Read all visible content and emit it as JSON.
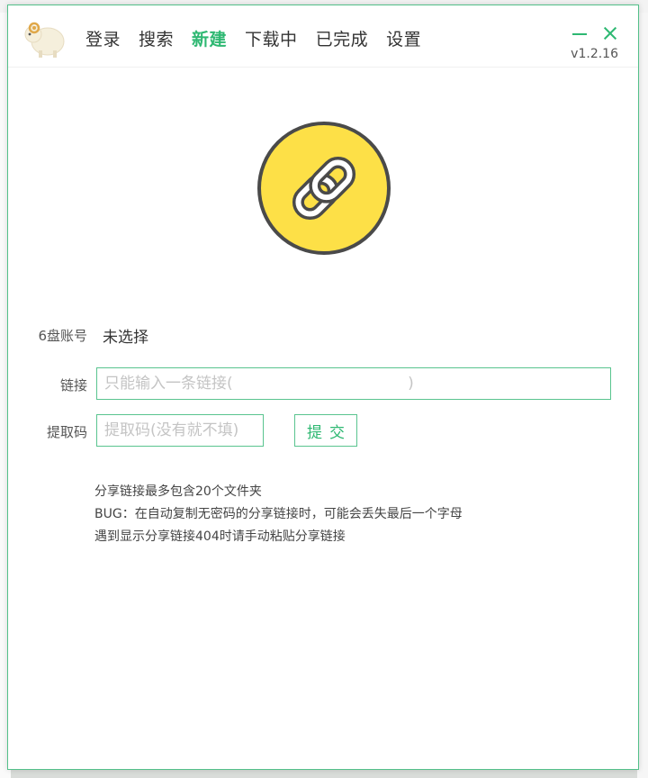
{
  "nav": {
    "items": [
      {
        "label": "登录",
        "active": false
      },
      {
        "label": "搜索",
        "active": false
      },
      {
        "label": "新建",
        "active": true
      },
      {
        "label": "下载中",
        "active": false
      },
      {
        "label": "已完成",
        "active": false
      },
      {
        "label": "设置",
        "active": false
      }
    ]
  },
  "app": {
    "version": "v1.2.16"
  },
  "icons": {
    "logo": "sheep-logo-icon",
    "main": "chain-link-icon",
    "minimize": "minimize-icon",
    "close": "close-icon"
  },
  "colors": {
    "accent": "#2eb872",
    "border": "#59c48f",
    "link_circle_fill": "#fde047",
    "link_circle_stroke": "#4a4a4a"
  },
  "form": {
    "account_label": "6盘账号",
    "account_value": "未选择",
    "link_label": "链接",
    "link_placeholder": "只能输入一条链接(                                    )",
    "link_value": "",
    "code_label": "提取码",
    "code_placeholder": "提取码(没有就不填)",
    "code_value": "",
    "submit_label": "提交"
  },
  "notes": [
    "分享链接最多包含20个文件夹",
    "BUG：在自动复制无密码的分享链接时，可能会丢失最后一个字母",
    "遇到显示分享链接404时请手动粘贴分享链接"
  ]
}
